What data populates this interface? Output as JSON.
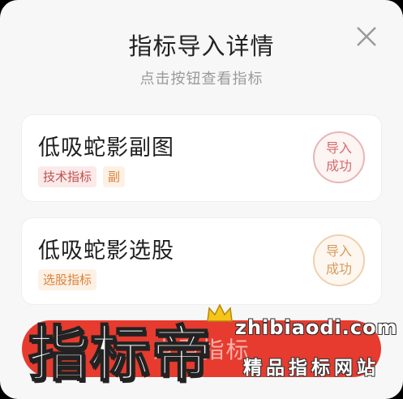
{
  "dialog": {
    "title": "指标导入详情",
    "subtitle": "点击按钮查看指标",
    "close_icon": "close-icon"
  },
  "items": [
    {
      "name": "低吸蛇影副图",
      "tags": [
        {
          "label": "技术指标",
          "color": "#c0504d",
          "bg": "#fbeaea"
        },
        {
          "label": "副",
          "color": "#d9823b",
          "bg": "#fdf1e6"
        }
      ],
      "status_line1": "导入",
      "status_line2": "成功",
      "status_color": "red"
    },
    {
      "name": "低吸蛇影选股",
      "tags": [
        {
          "label": "选股指标",
          "color": "#d9823b",
          "bg": "#fdf1e6"
        }
      ],
      "status_line1": "导入",
      "status_line2": "成功",
      "status_color": "orange"
    }
  ],
  "bottom_button": {
    "label": "查看指标",
    "color": "#e63b2e"
  },
  "watermark": {
    "logo_text": "指标帝",
    "url": "zhibiaodi.com",
    "slogan": "精品指标网站"
  }
}
